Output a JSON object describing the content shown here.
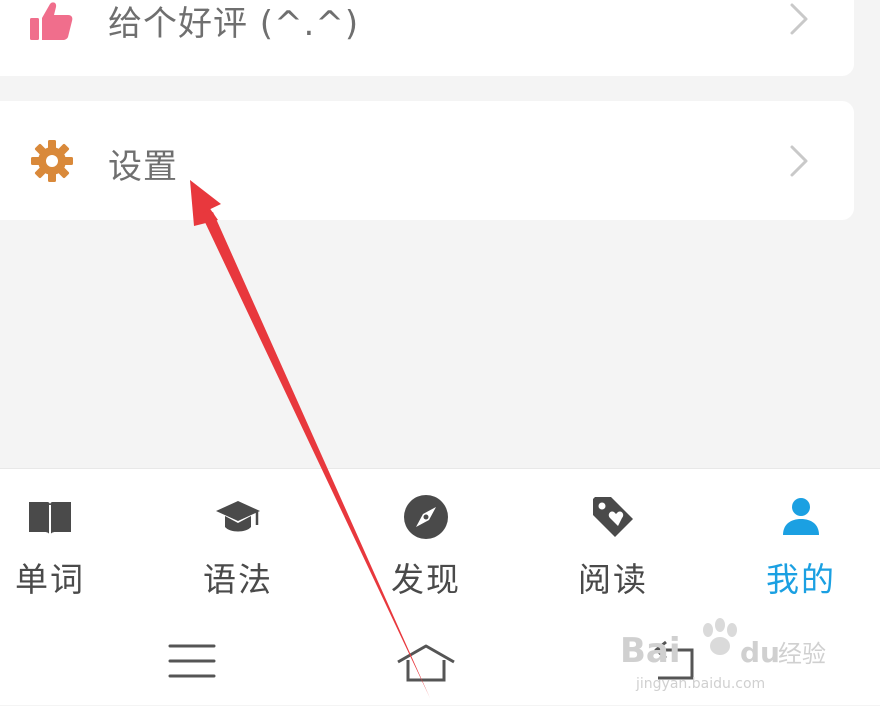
{
  "menu": {
    "rate_label": "给个好评  (^.^)",
    "settings_label": "设置"
  },
  "tabs": [
    {
      "label": "单词",
      "icon": "book-icon"
    },
    {
      "label": "语法",
      "icon": "graduation-cap-icon"
    },
    {
      "label": "发现",
      "icon": "compass-icon"
    },
    {
      "label": "阅读",
      "icon": "tag-heart-icon"
    },
    {
      "label": "我的",
      "icon": "user-icon",
      "active": true
    }
  ],
  "nav": {
    "menu_icon": "menu-icon",
    "home_icon": "home-icon",
    "back_icon": "back-icon"
  },
  "watermark": {
    "brand": "Bai",
    "brand_tail": "du",
    "cn": "经验",
    "url": "jingyan.baidu.com"
  },
  "colors": {
    "accent": "#1ba0e2",
    "thumb_icon": "#f06e8c",
    "gear_icon": "#d9893a",
    "arrow": "#e8383d"
  }
}
